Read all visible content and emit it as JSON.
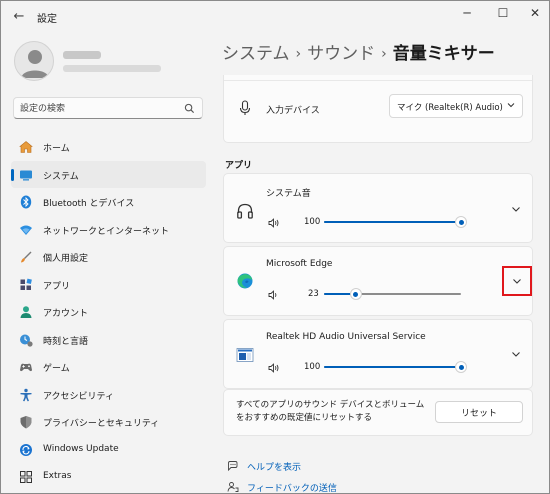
{
  "window": {
    "title": "設定",
    "back_glyph": "←",
    "minimize_glyph": "─",
    "maximize_glyph": "☐",
    "close_glyph": "✕"
  },
  "search": {
    "placeholder": "設定の検索"
  },
  "sidebar": {
    "items": [
      {
        "label": "ホーム",
        "icon": "home-icon"
      },
      {
        "label": "システム",
        "icon": "system-icon",
        "active": true
      },
      {
        "label": "Bluetooth とデバイス",
        "icon": "bluetooth-icon"
      },
      {
        "label": "ネットワークとインターネット",
        "icon": "network-icon"
      },
      {
        "label": "個人用設定",
        "icon": "personalization-icon"
      },
      {
        "label": "アプリ",
        "icon": "apps-icon"
      },
      {
        "label": "アカウント",
        "icon": "account-icon"
      },
      {
        "label": "時刻と言語",
        "icon": "time-language-icon"
      },
      {
        "label": "ゲーム",
        "icon": "gaming-icon"
      },
      {
        "label": "アクセシビリティ",
        "icon": "accessibility-icon"
      },
      {
        "label": "プライバシーとセキュリティ",
        "icon": "privacy-icon"
      },
      {
        "label": "Windows Update",
        "icon": "windows-update-icon"
      },
      {
        "label": "Extras",
        "icon": "extras-icon"
      }
    ]
  },
  "breadcrumb": {
    "level1": "システム",
    "level2": "サウンド",
    "current": "音量ミキサー",
    "separator": "›"
  },
  "input_device": {
    "label": "入力デバイス",
    "selected": "マイク (Realtek(R) Audio)"
  },
  "apps_section": {
    "label": "アプリ",
    "apps": [
      {
        "name": "システム音",
        "volume": 100,
        "icon": "headphones-icon"
      },
      {
        "name": "Microsoft Edge",
        "volume": 23,
        "icon": "edge-icon"
      },
      {
        "name": "Realtek HD Audio Universal Service",
        "volume": 100,
        "icon": "realtek-icon"
      }
    ]
  },
  "reset": {
    "text": "すべてのアプリのサウンド デバイスとボリュームをおすすめの既定値にリセットする",
    "button_label": "リセット"
  },
  "links": {
    "help": "ヘルプを表示",
    "feedback": "フィードバックの送信"
  },
  "colors": {
    "accent": "#005fb8",
    "highlight_box": "#e0171c"
  }
}
